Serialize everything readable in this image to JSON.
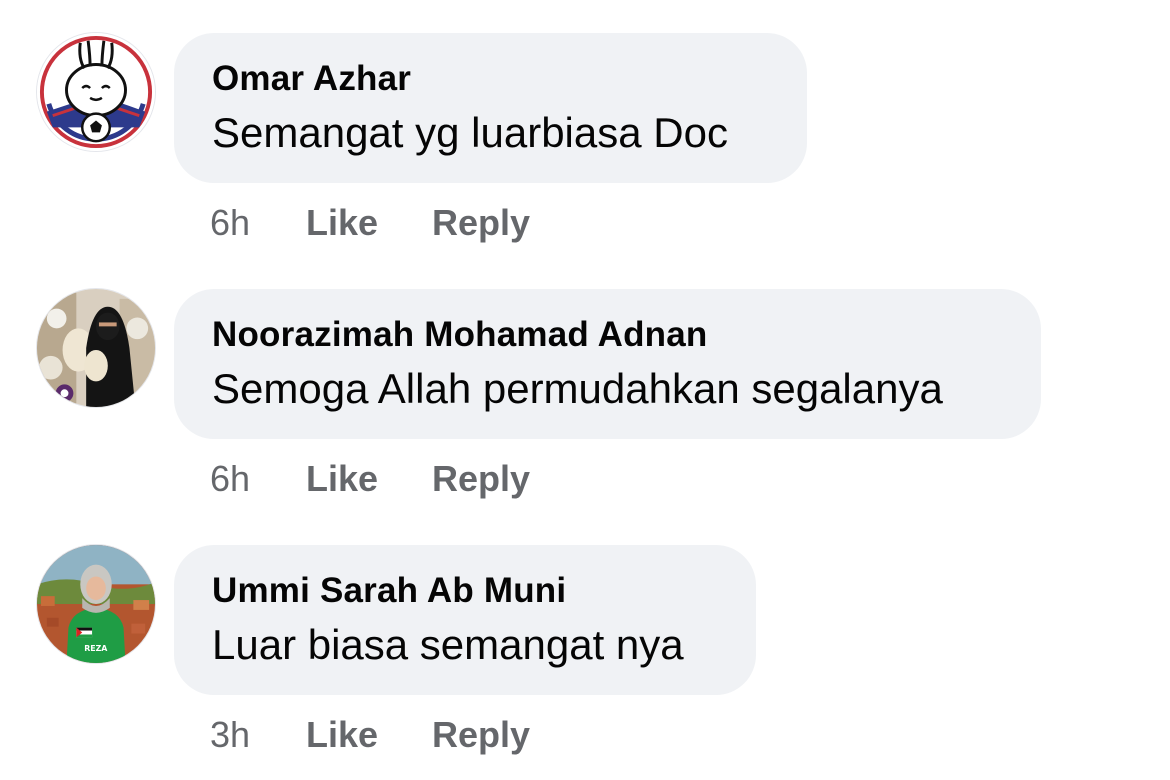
{
  "comments": [
    {
      "author": "Omar Azhar",
      "text": "Semangat yg luarbiasa Doc",
      "time": "6h",
      "like_label": "Like",
      "reply_label": "Reply",
      "avatar_icon": "cartoon-rabbit-football-avatar"
    },
    {
      "author": "Noorazimah Mohamad Adnan",
      "text": "Semoga Allah permudahkan segalanya",
      "time": "6h",
      "like_label": "Like",
      "reply_label": "Reply",
      "avatar_icon": "niqab-woman-photo-avatar"
    },
    {
      "author": "Ummi Sarah Ab Muni",
      "text": "Luar biasa semangat nya",
      "time": "3h",
      "like_label": "Like",
      "reply_label": "Reply",
      "avatar_icon": "hijab-woman-green-hoodie-avatar",
      "avatar_hoodie_text": "REZA"
    }
  ],
  "colors": {
    "bubble_bg": "#f0f2f5",
    "primary_text": "#050505",
    "secondary_text": "#65676b"
  }
}
